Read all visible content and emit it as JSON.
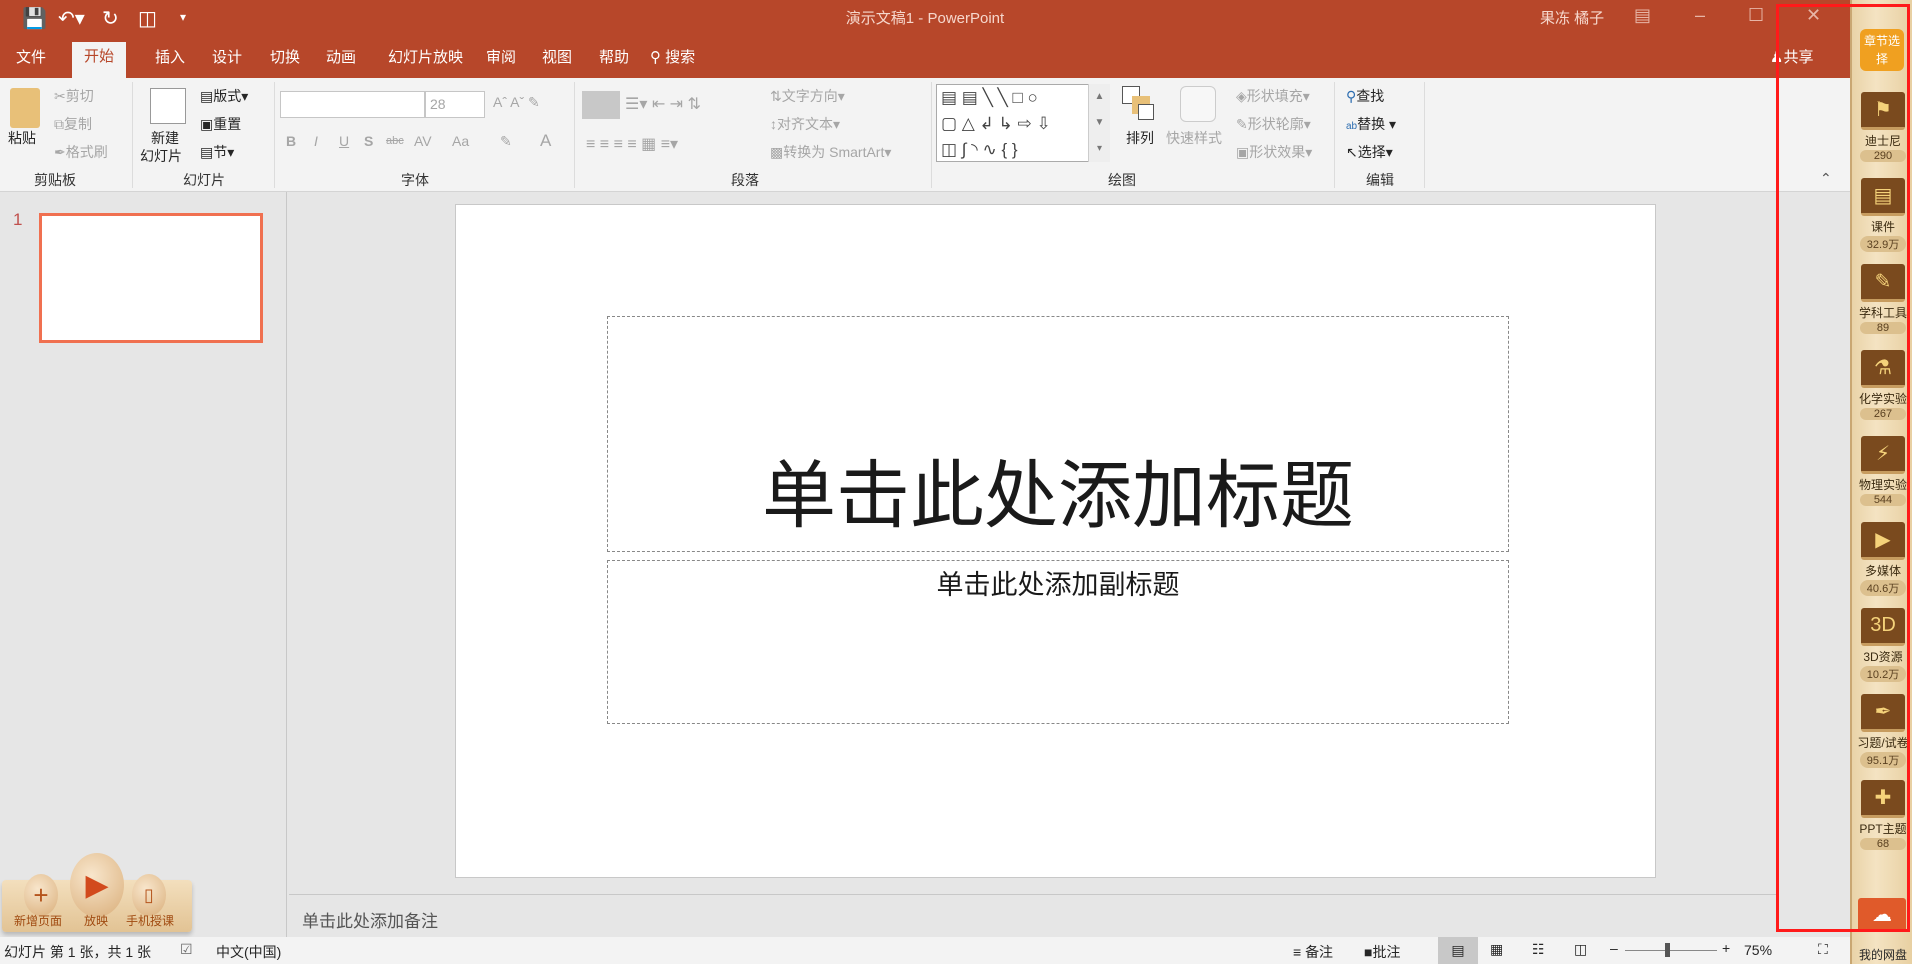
{
  "window": {
    "title": "演示文稿1  -  PowerPoint",
    "user": "果冻 橘子",
    "colors": {
      "accent": "#b7472a",
      "thumb_border": "#f07050",
      "annotation_box": "#ff1a1a"
    }
  },
  "quick_access": {
    "save": "save-icon",
    "undo": "undo-icon",
    "redo": "repeat-icon",
    "present": "present-icon",
    "customize": "customize-icon"
  },
  "tabs": [
    {
      "label": "文件"
    },
    {
      "label": "开始",
      "active": true
    },
    {
      "label": "插入"
    },
    {
      "label": "设计"
    },
    {
      "label": "切换"
    },
    {
      "label": "动画"
    },
    {
      "label": "幻灯片放映"
    },
    {
      "label": "审阅"
    },
    {
      "label": "视图"
    },
    {
      "label": "帮助"
    },
    {
      "label": "搜索"
    }
  ],
  "share": "共享",
  "ribbon": {
    "clipboard": {
      "label": "剪贴板",
      "paste": "粘贴",
      "cut": "剪切",
      "copy": "复制",
      "format_painter": "格式刷"
    },
    "slides": {
      "label": "幻灯片",
      "new_slide_1": "新建",
      "new_slide_2": "幻灯片",
      "layout": "版式",
      "reset": "重置",
      "section": "节"
    },
    "font": {
      "label": "字体",
      "font_name": "",
      "font_size": "28",
      "bold": "B",
      "italic": "I",
      "underline": "U",
      "shadow": "S",
      "strike": "abc",
      "spacing": "AV",
      "case": "Aa",
      "color": "A"
    },
    "paragraph": {
      "label": "段落",
      "text_direction": "文字方向",
      "align_text": "对齐文本",
      "smartart": "转换为 SmartArt"
    },
    "drawing": {
      "label": "绘图",
      "arrange": "排列",
      "quick_styles": "快速样式",
      "shape_fill": "形状填充",
      "shape_outline": "形状轮廓",
      "shape_effects": "形状效果"
    },
    "editing": {
      "label": "编辑",
      "find": "查找",
      "replace": "替换",
      "select": "选择"
    }
  },
  "thumbnails": [
    {
      "number": "1"
    }
  ],
  "slide": {
    "title_placeholder": "单击此处添加标题",
    "subtitle_placeholder": "单击此处添加副标题"
  },
  "notes_placeholder": "单击此处添加备注",
  "addin": {
    "new_page": "新增页面",
    "play": "放映",
    "mobile": "手机授课"
  },
  "status": {
    "slide_info": "幻灯片 第 1 张，共 1 张",
    "language": "中文(中国)",
    "notes": "备注",
    "comments": "批注",
    "zoom": "75%",
    "zoom_level": 75
  },
  "sidebar": {
    "chapter": "章节选择",
    "items": [
      {
        "label": "迪士尼",
        "count": "290",
        "icon": "flag-icon"
      },
      {
        "label": "课件",
        "count": "32.9万",
        "icon": "book-icon"
      },
      {
        "label": "学科工具",
        "count": "89",
        "icon": "toolbox-icon"
      },
      {
        "label": "化学实验",
        "count": "267",
        "icon": "beaker-icon"
      },
      {
        "label": "物理实验",
        "count": "544",
        "icon": "battery-icon"
      },
      {
        "label": "多媒体",
        "count": "40.6万",
        "icon": "clapper-icon"
      },
      {
        "label": "3D资源",
        "count": "10.2万",
        "icon": "3d-icon"
      },
      {
        "label": "习题/试卷",
        "count": "95.1万",
        "icon": "palette-icon"
      },
      {
        "label": "PPT主题",
        "count": "68",
        "icon": "theme-icon"
      }
    ],
    "cloud": "我的网盘"
  }
}
